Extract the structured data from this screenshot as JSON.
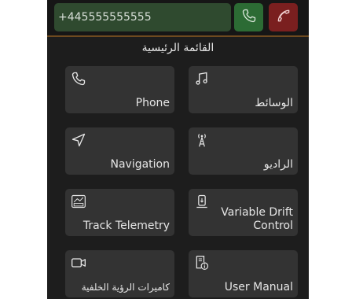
{
  "call_bar": {
    "phone_number": "+445555555555",
    "accept_icon": "phone-icon",
    "hangup_icon": "hang-up-icon"
  },
  "menu": {
    "title": "القائمة الرئيسية",
    "tiles": [
      {
        "label": "Phone",
        "icon": "phone-icon"
      },
      {
        "label": "الوسائط",
        "icon": "music-note-icon"
      },
      {
        "label": "Navigation",
        "icon": "navigation-arrow-icon"
      },
      {
        "label": "الراديو",
        "icon": "radio-antenna-icon"
      },
      {
        "label": "Track Telemetry",
        "icon": "telemetry-gauge-icon"
      },
      {
        "label": "Variable Drift Control",
        "icon": "drift-control-icon"
      },
      {
        "label": "كاميرات الرؤية الخلفية",
        "icon": "camera-icon"
      },
      {
        "label": "User Manual",
        "icon": "manual-info-icon"
      }
    ]
  },
  "colors": {
    "screen_bg": "#1d1d1d",
    "tile_bg": "#333333",
    "accept": "#2c6b34",
    "hangup": "#7a1f1f",
    "phone_field": "#2f4a2f",
    "accent_line": "#6e4a1f"
  }
}
